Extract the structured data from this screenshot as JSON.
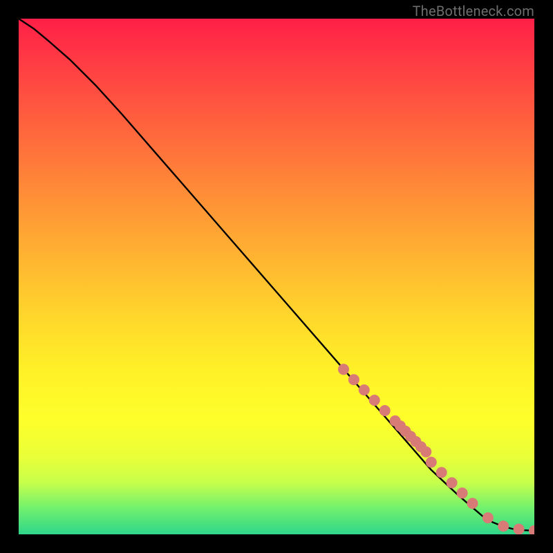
{
  "attribution": "TheBottleneck.com",
  "colors": {
    "page_bg": "#000000",
    "line": "#000000",
    "marker": "#d87a75",
    "gradient_top": "#ff1f47",
    "gradient_bottom": "#2fd68a"
  },
  "chart_data": {
    "type": "line",
    "title": "",
    "xlabel": "",
    "ylabel": "",
    "xlim": [
      0,
      100
    ],
    "ylim": [
      0,
      100
    ],
    "grid": false,
    "series": [
      {
        "name": "curve",
        "x": [
          0,
          3,
          6,
          10,
          15,
          20,
          30,
          40,
          50,
          60,
          70,
          80,
          85,
          88,
          90,
          92,
          94,
          96,
          98,
          100
        ],
        "y": [
          100,
          98,
          95.5,
          92,
          87,
          81.5,
          70,
          58.5,
          47,
          35.5,
          24,
          12.5,
          7.8,
          5.2,
          3.5,
          2.3,
          1.5,
          1.0,
          0.8,
          0.7
        ]
      }
    ],
    "markers": {
      "name": "highlighted-points",
      "x": [
        63,
        65,
        67,
        69,
        71,
        73,
        74,
        75,
        76,
        77,
        78,
        79,
        80,
        82,
        84,
        86,
        88,
        91,
        94,
        97,
        100
      ],
      "y": [
        32,
        30,
        28,
        26,
        24,
        22,
        21,
        20,
        19,
        18,
        17,
        16,
        14,
        12,
        10,
        8,
        6,
        3.2,
        1.6,
        1.0,
        0.7
      ]
    }
  }
}
